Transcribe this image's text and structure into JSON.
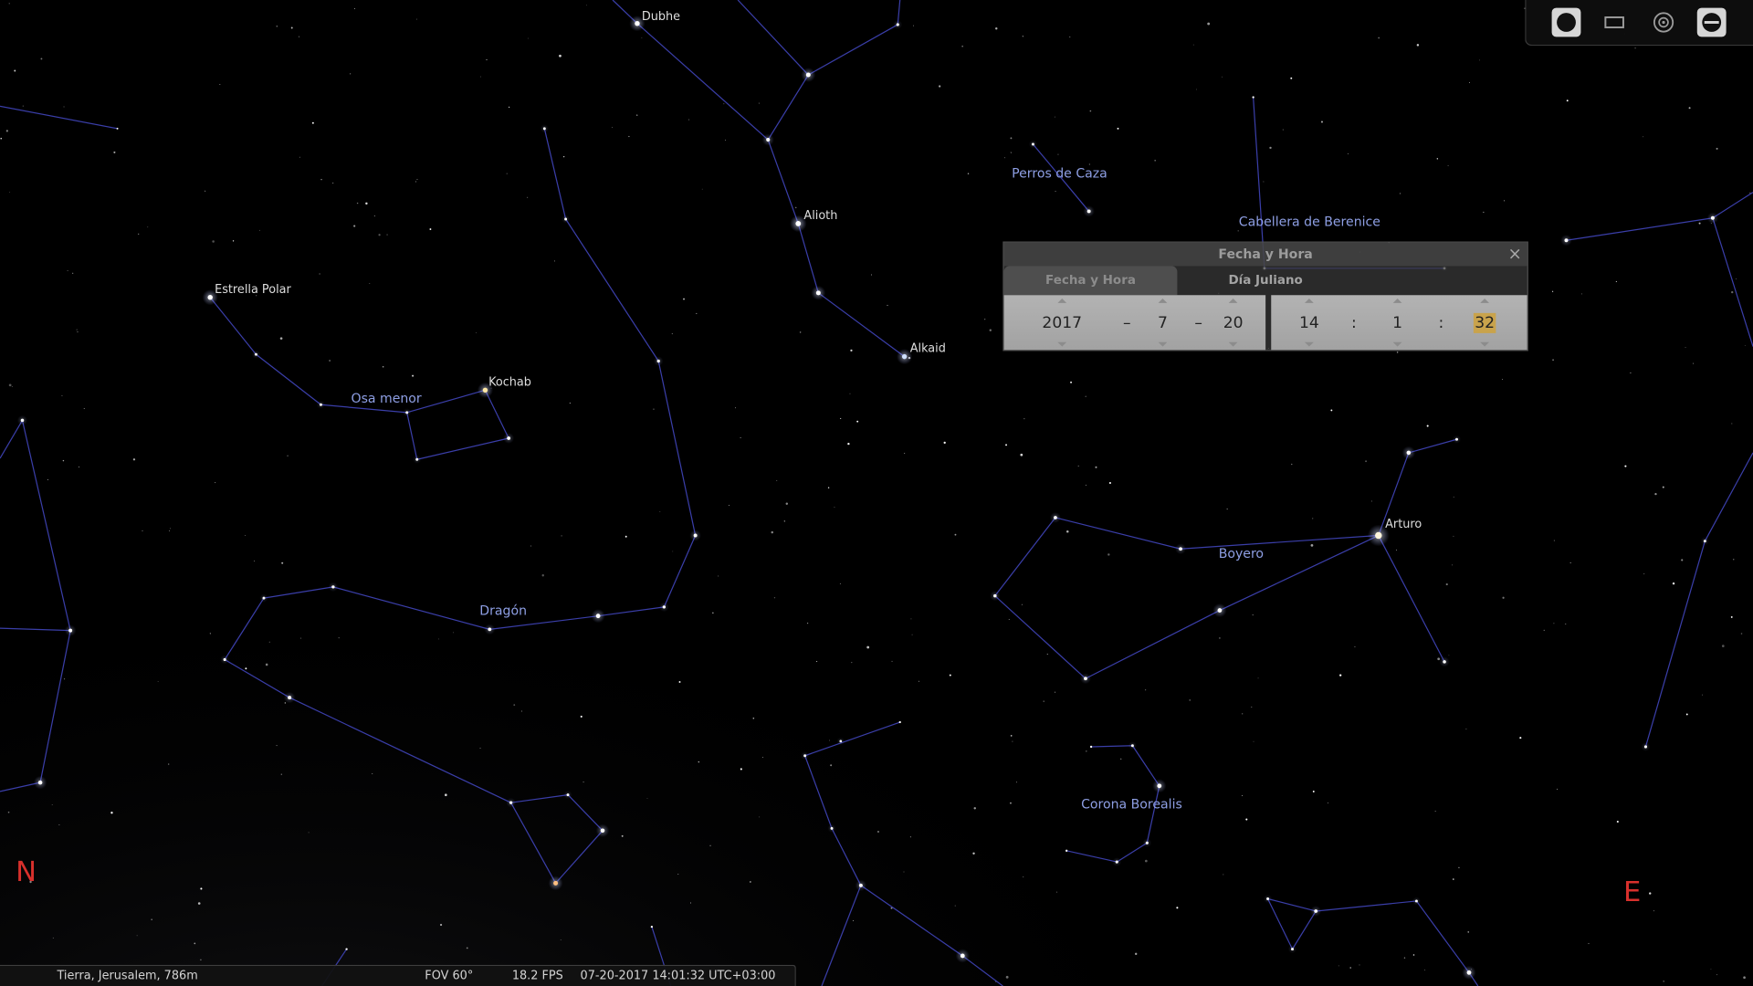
{
  "sky": {
    "star_labels": {
      "dubhe": "Dubhe",
      "alioth": "Alioth",
      "alkaid": "Alkaid",
      "polaris": "Estrella Polar",
      "kochab": "Kochab",
      "arcturus": "Arturo"
    },
    "constellation_labels": {
      "ursa_minor": "Osa menor",
      "draco": "Dragón",
      "canes_venatici": "Perros de Caza",
      "coma_berenices": "Cabellera de Berenice",
      "bootes": "Boyero",
      "corona_borealis": "Corona Borealis"
    },
    "cardinals": {
      "north": "N",
      "east": "E"
    }
  },
  "toolbar": {
    "icons": [
      {
        "icon": "filled-circle-icon",
        "active": true
      },
      {
        "icon": "rectangle-frame-icon",
        "active": false
      },
      {
        "icon": "target-icon",
        "active": false
      },
      {
        "icon": "eyepiece-icon",
        "active": true
      }
    ]
  },
  "dialog": {
    "title": "Fecha y Hora",
    "close_glyph": "×",
    "tabs": [
      {
        "label": "Fecha y Hora",
        "active": true
      },
      {
        "label": "Día Juliano",
        "active": false
      }
    ],
    "date": {
      "year": "2017",
      "month": "7",
      "day": "20",
      "separator": "–"
    },
    "time": {
      "hour": "14",
      "minute": "1",
      "second": "32",
      "separator": ":",
      "second_selected": true
    }
  },
  "status_bar": {
    "location": "Tierra, Jerusalem, 786m",
    "fov": "FOV 60°",
    "fps": "18.2 FPS",
    "datetime": "07-20-2017 14:01:32 UTC+03:00"
  },
  "colors": {
    "sky_background": "#000000",
    "constellation_line": "#3a3ea8",
    "constellation_label": "#8e9fe4",
    "star_label": "#dedede",
    "cardinal_point": "#d8302c",
    "selected_field": "#c9a34c",
    "status_text": "#d4d4d4"
  }
}
